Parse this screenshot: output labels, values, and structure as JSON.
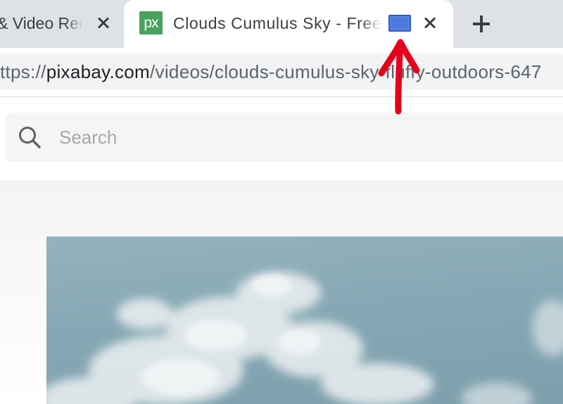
{
  "browser": {
    "tabs": [
      {
        "title": "& Video Recordings",
        "active": false
      },
      {
        "title": "Clouds Cumulus Sky - Free Video",
        "active": true,
        "favicon_text": "px",
        "favicon_color": "#48a15c"
      }
    ],
    "address": {
      "scheme_prefix": "ttps://",
      "host": "pixabay.com",
      "path": "/videos/clouds-cumulus-sky-fluffy-outdoors-647"
    }
  },
  "page": {
    "search": {
      "placeholder": "Search",
      "icon": "search-icon"
    },
    "video": {
      "description_colors": {
        "sky": "#86a8b4",
        "cloud": "#e8edee"
      }
    }
  },
  "annotation": {
    "color": "#e4001b",
    "target": "picture-in-picture-icon"
  }
}
